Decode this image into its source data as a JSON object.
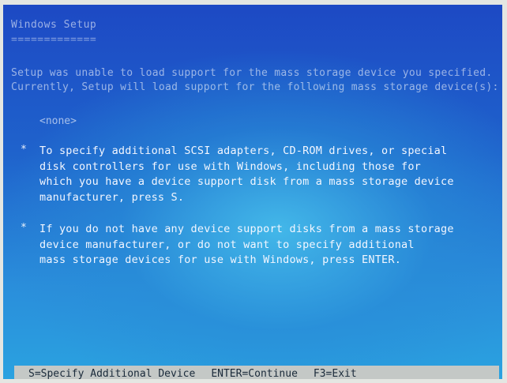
{
  "setup": {
    "title": "Windows Setup",
    "title_underline": "=============",
    "intro_line1": "Setup was unable to load support for the mass storage device you specified.",
    "intro_line2": "Currently, Setup will load support for the following mass storage device(s):",
    "device_list_item": "<none>",
    "bullet": "*",
    "option_specify": "To specify additional SCSI adapters, CD-ROM drives, or special\ndisk controllers for use with Windows, including those for\nwhich you have a device support disk from a mass storage device\nmanufacturer, press S.",
    "option_continue": "If you do not have any device support disks from a mass storage\ndevice manufacturer, or do not want to specify additional\nmass storage devices for use with Windows, press ENTER."
  },
  "statusbar": {
    "specify": "S=Specify Additional Device",
    "continue": "ENTER=Continue",
    "exit": "F3=Exit"
  }
}
